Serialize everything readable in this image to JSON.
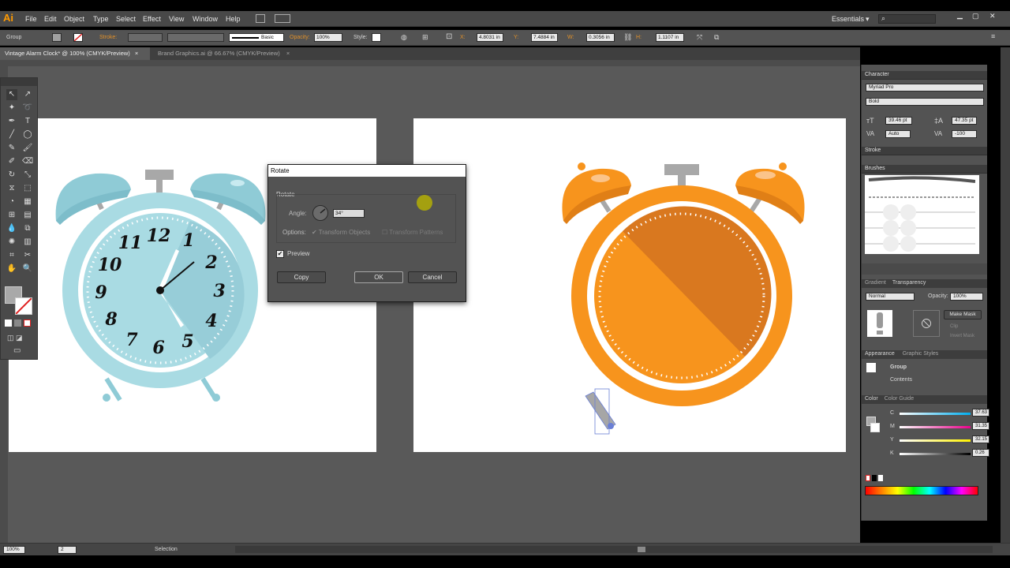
{
  "app": {
    "logo": "Ai"
  },
  "menu": [
    "File",
    "Edit",
    "Object",
    "Type",
    "Select",
    "Effect",
    "View",
    "Window",
    "Help"
  ],
  "workspace": "Essentials",
  "control": {
    "selection_type": "Group",
    "stroke_label": "Stroke:",
    "brush": "Basic",
    "opacity_label": "Opacity:",
    "opacity": "100%",
    "style_label": "Style:",
    "x_label": "X:",
    "x": "4.8031 in",
    "y_label": "Y:",
    "y": "7.4884 in",
    "w_label": "W:",
    "w": "0.3056 in",
    "h_label": "H:",
    "h": "1.1107 in"
  },
  "tabs": [
    "Vintage Alarm Clock* @ 100% (CMYK/Preview)",
    "Brand Graphics.ai @ 66.67% (CMYK/Preview)"
  ],
  "dialog": {
    "title": "Rotate",
    "section": "Rotate",
    "angle_label": "Angle:",
    "angle": "34°",
    "options_label": "Options:",
    "opt1": "Transform Objects",
    "opt2": "Transform Patterns",
    "preview": "Preview",
    "copy": "Copy",
    "ok": "OK",
    "cancel": "Cancel"
  },
  "clock_numbers": [
    "12",
    "1",
    "2",
    "3",
    "4",
    "5",
    "6",
    "7",
    "8",
    "9",
    "10",
    "11"
  ],
  "character": {
    "header": "Character",
    "font": "Myriad Pro",
    "weight": "Bold",
    "size": "39.46 pt",
    "leading": "47.35 pt",
    "kerning": "Auto",
    "tracking": "-100"
  },
  "stroke": {
    "header": "Stroke"
  },
  "brushes": {
    "header": "Brushes"
  },
  "transparency": {
    "tab1": "Gradient",
    "tab2": "Transparency",
    "mode": "Normal",
    "opacity_label": "Opacity:",
    "opacity": "100%",
    "make_mask": "Make Mask",
    "clip": "Clip",
    "invert": "Invert Mask"
  },
  "appearance": {
    "tab1": "Appearance",
    "tab2": "Graphic Styles",
    "item": "Group",
    "contents": "Contents"
  },
  "color": {
    "tab1": "Color",
    "tab2": "Color Guide",
    "c_label": "C",
    "c": "37.63",
    "m_label": "M",
    "m": "31.35",
    "y_label": "Y",
    "y": "32.15",
    "k_label": "K",
    "k": "0.26",
    "pct": "%"
  },
  "status": {
    "zoom": "100%",
    "page": "2",
    "tool": "Selection"
  },
  "colors": {
    "accent": "#ff9a00",
    "clock_blue": "#a9dbe3",
    "clock_orange": "#f7941d"
  }
}
